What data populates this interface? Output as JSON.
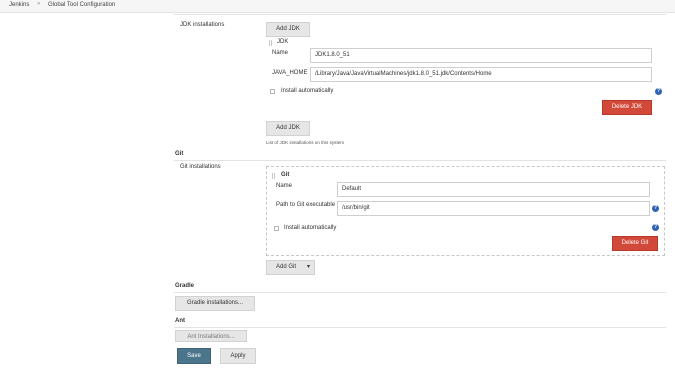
{
  "breadcrumb": {
    "items": [
      "Jenkins",
      "Global Tool Configuration"
    ],
    "separator": "»"
  },
  "jdk": {
    "label": "JDK installations",
    "add_button": "Add JDK",
    "item_title": "JDK",
    "name_label": "Name",
    "name_value": "JDK1.8.0_51",
    "home_label": "JAVA_HOME",
    "home_value": "/Library/Java/JavaVirtualMachines/jdk1.8.0_51.jdk/Contents/Home",
    "install_label": "Install automatically",
    "install_checked": false,
    "delete_button": "Delete JDK",
    "list_note": "List of JDK installations on this system"
  },
  "git": {
    "section_title": "Git",
    "label": "Git installations",
    "item_title": "Git",
    "name_label": "Name",
    "name_value": "Default",
    "path_label": "Path to Git executable",
    "path_value": "/usr/bin/git",
    "install_label": "Install automatically",
    "install_checked": false,
    "delete_button": "Delete Git",
    "add_button": "Add Git",
    "add_arrow": "▾"
  },
  "gradle": {
    "section_title": "Gradle",
    "button": "Gradle installations..."
  },
  "ant": {
    "section_title": "Ant",
    "button": "Ant Installations..."
  },
  "footer": {
    "save_button": "Save",
    "apply_button": "Apply"
  },
  "icons": {
    "help": "?"
  },
  "colors": {
    "delete": "#d24939",
    "save": "#4b758b",
    "help": "#2f64b5"
  }
}
